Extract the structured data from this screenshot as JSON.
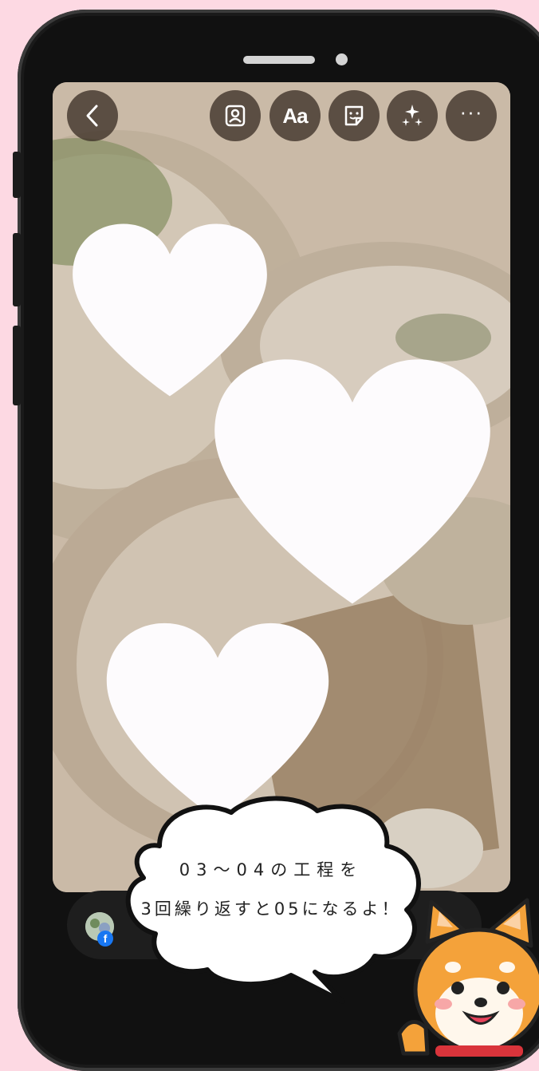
{
  "toolbar": {
    "back_icon": "chevron-left-icon",
    "items": [
      {
        "name": "portrait-icon"
      },
      {
        "label": "Aa"
      },
      {
        "name": "sticker-icon"
      },
      {
        "name": "sparkles-icon"
      },
      {
        "label": "···"
      }
    ]
  },
  "stickers": [
    "heart-small",
    "heart-large",
    "heart-medium"
  ],
  "callout": {
    "line1": "03～04の工程を",
    "line2": "3回繰り返すと05になるよ！"
  },
  "colors": {
    "background": "#fdd9e3",
    "phone_frame": "#111111",
    "heart": "#fdfbfd",
    "toolbar_button": "#3c3026"
  }
}
